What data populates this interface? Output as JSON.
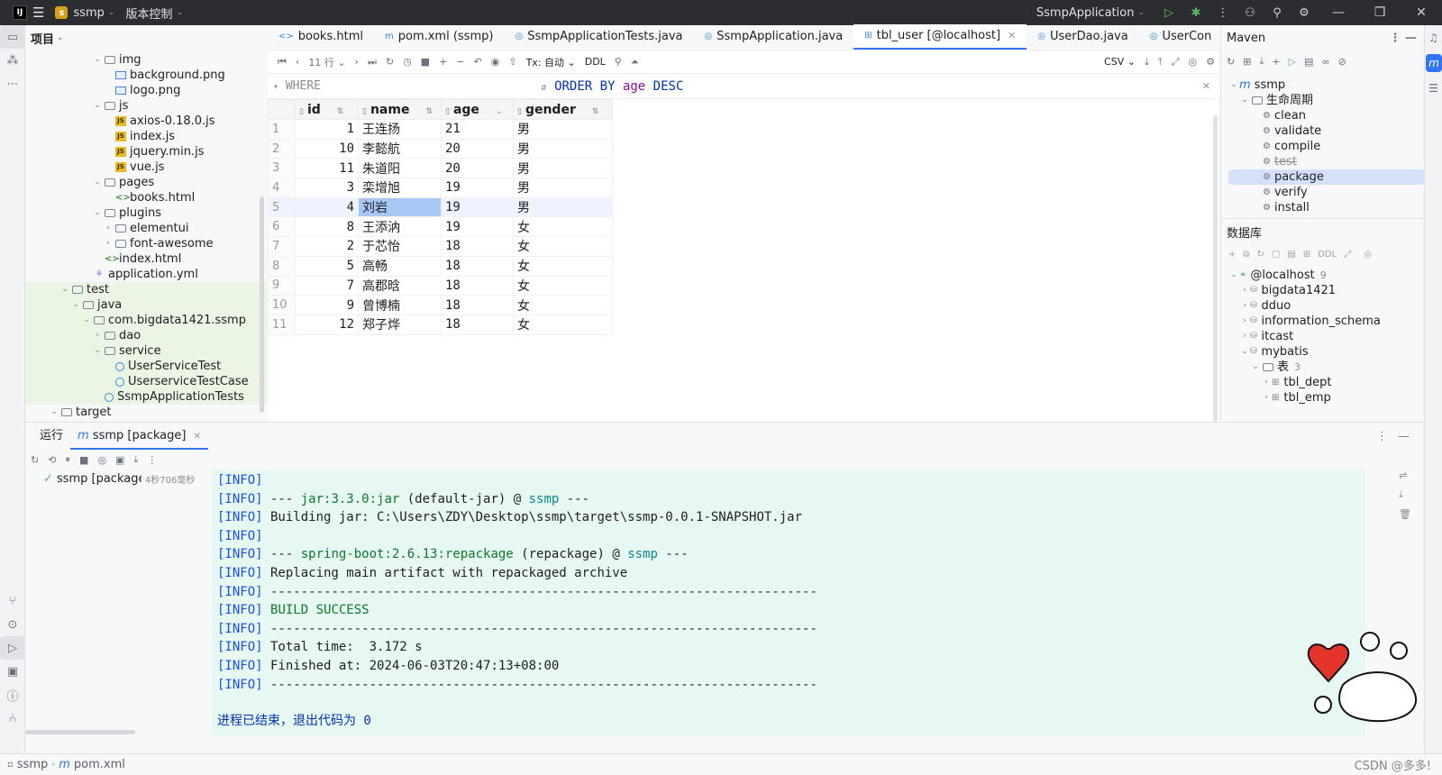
{
  "titlebar": {
    "app_logo": "IJ",
    "project_badge": "s",
    "project_name": "ssmp",
    "vcs_menu": "版本控制",
    "run_config": "SsmpApplication"
  },
  "project_panel": {
    "title": "项目",
    "tree": [
      {
        "label": "img",
        "icon": "folder",
        "indent": 6,
        "tw": "⌄"
      },
      {
        "label": "background.png",
        "icon": "img",
        "indent": 7,
        "tw": ""
      },
      {
        "label": "logo.png",
        "icon": "img",
        "indent": 7,
        "tw": ""
      },
      {
        "label": "js",
        "icon": "folder",
        "indent": 6,
        "tw": "⌄"
      },
      {
        "label": "axios-0.18.0.js",
        "icon": "js",
        "indent": 7,
        "tw": ""
      },
      {
        "label": "index.js",
        "icon": "js",
        "indent": 7,
        "tw": ""
      },
      {
        "label": "jquery.min.js",
        "icon": "js",
        "indent": 7,
        "tw": ""
      },
      {
        "label": "vue.js",
        "icon": "js",
        "indent": 7,
        "tw": ""
      },
      {
        "label": "pages",
        "icon": "folder",
        "indent": 6,
        "tw": "⌄"
      },
      {
        "label": "books.html",
        "icon": "html",
        "indent": 7,
        "tw": ""
      },
      {
        "label": "plugins",
        "icon": "folder",
        "indent": 6,
        "tw": "⌄"
      },
      {
        "label": "elementui",
        "icon": "folder",
        "indent": 7,
        "tw": "›"
      },
      {
        "label": "font-awesome",
        "icon": "folder",
        "indent": 7,
        "tw": "›"
      },
      {
        "label": "index.html",
        "icon": "html",
        "indent": 6,
        "tw": ""
      },
      {
        "label": "application.yml",
        "icon": "yml",
        "indent": 5,
        "tw": ""
      },
      {
        "label": "test",
        "icon": "folder",
        "indent": 3,
        "tw": "⌄",
        "green": true
      },
      {
        "label": "java",
        "icon": "folder",
        "indent": 4,
        "tw": "⌄",
        "green": true
      },
      {
        "label": "com.bigdata1421.ssmp",
        "icon": "folder",
        "indent": 5,
        "tw": "⌄",
        "green": true
      },
      {
        "label": "dao",
        "icon": "folder",
        "indent": 6,
        "tw": "›",
        "green": true
      },
      {
        "label": "service",
        "icon": "folder",
        "indent": 6,
        "tw": "⌄",
        "green": true
      },
      {
        "label": "UserServiceTest",
        "icon": "class",
        "indent": 7,
        "tw": "",
        "green": true
      },
      {
        "label": "UserserviceTestCase",
        "icon": "class",
        "indent": 7,
        "tw": "",
        "green": true
      },
      {
        "label": "SsmpApplicationTests",
        "icon": "class",
        "indent": 6,
        "tw": "",
        "green": true
      },
      {
        "label": "target",
        "icon": "folder",
        "indent": 2,
        "tw": "⌄"
      }
    ]
  },
  "editor": {
    "tabs": [
      {
        "label": "books.html",
        "icon": "<>",
        "active": false
      },
      {
        "label": "pom.xml (ssmp)",
        "icon": "m",
        "active": false
      },
      {
        "label": "SsmpApplicationTests.java",
        "icon": "◎",
        "active": false
      },
      {
        "label": "SsmpApplication.java",
        "icon": "◎",
        "active": false
      },
      {
        "label": "tbl_user [@localhost]",
        "icon": "⊞",
        "active": true
      },
      {
        "label": "UserDao.java",
        "icon": "◎",
        "active": false
      },
      {
        "label": "UserCon",
        "icon": "◎",
        "active": false
      }
    ],
    "grid_toolbar": {
      "rows_label": "11 行",
      "tx_label": "Tx: 自动",
      "ddl_label": "DDL",
      "export_label": "CSV"
    },
    "filter": {
      "where_label": "WHERE",
      "order_by": "ORDER BY",
      "order_col": "age",
      "order_dir": "DESC"
    },
    "table": {
      "columns": [
        "id",
        "name",
        "age",
        "gender"
      ],
      "rows": [
        {
          "n": "1",
          "id": "1",
          "name": "王连扬",
          "age": "21",
          "gender": "男"
        },
        {
          "n": "2",
          "id": "10",
          "name": "李懿航",
          "age": "20",
          "gender": "男"
        },
        {
          "n": "3",
          "id": "11",
          "name": "朱道阳",
          "age": "20",
          "gender": "男"
        },
        {
          "n": "4",
          "id": "3",
          "name": "栾增旭",
          "age": "19",
          "gender": "男"
        },
        {
          "n": "5",
          "id": "4",
          "name": "刘岩",
          "age": "19",
          "gender": "男",
          "selected": true
        },
        {
          "n": "6",
          "id": "8",
          "name": "王添汭",
          "age": "19",
          "gender": "女"
        },
        {
          "n": "7",
          "id": "2",
          "name": "于芯怡",
          "age": "18",
          "gender": "女"
        },
        {
          "n": "8",
          "id": "5",
          "name": "高畅",
          "age": "18",
          "gender": "女"
        },
        {
          "n": "9",
          "id": "7",
          "name": "高郡晗",
          "age": "18",
          "gender": "女"
        },
        {
          "n": "10",
          "id": "9",
          "name": "曾博楠",
          "age": "18",
          "gender": "女"
        },
        {
          "n": "11",
          "id": "12",
          "name": "郑子烨",
          "age": "18",
          "gender": "女"
        }
      ]
    }
  },
  "maven": {
    "title": "Maven",
    "project": "ssmp",
    "lifecycle": "生命周期",
    "goals": [
      {
        "label": "clean",
        "strike": false,
        "selected": false
      },
      {
        "label": "validate",
        "strike": false,
        "selected": false
      },
      {
        "label": "compile",
        "strike": false,
        "selected": false
      },
      {
        "label": "test",
        "strike": true,
        "selected": false
      },
      {
        "label": "package",
        "strike": false,
        "selected": true
      },
      {
        "label": "verify",
        "strike": false,
        "selected": false
      },
      {
        "label": "install",
        "strike": false,
        "selected": false
      }
    ]
  },
  "database": {
    "title": "数据库",
    "host": "@localhost",
    "host_count": "9",
    "schemas": [
      "bigdata1421",
      "dduo",
      "information_schema",
      "itcast",
      "mybatis"
    ],
    "tables_label": "表",
    "tables_count": "3",
    "tables": [
      "tbl_dept",
      "tbl_emp"
    ]
  },
  "run": {
    "tab_run": "运行",
    "tab_config": "ssmp [package]",
    "tree_item": "ssmp [package]",
    "duration": "4秒706毫秒",
    "lines": [
      {
        "pre": "[INFO]",
        "parts": [
          {
            "t": "",
            "c": ""
          }
        ]
      },
      {
        "pre": "[INFO]",
        "parts": [
          {
            "t": " --- ",
            "c": ""
          },
          {
            "t": "jar:3.3.0:jar",
            "c": "grn"
          },
          {
            "t": " (default-jar) @ ",
            "c": ""
          },
          {
            "t": "ssmp",
            "c": "teal"
          },
          {
            "t": " ---",
            "c": ""
          }
        ]
      },
      {
        "pre": "[INFO]",
        "parts": [
          {
            "t": " Building jar: C:\\Users\\ZDY\\Desktop\\ssmp\\target\\ssmp-0.0.1-SNAPSHOT.jar",
            "c": ""
          }
        ]
      },
      {
        "pre": "[INFO]",
        "parts": [
          {
            "t": "",
            "c": ""
          }
        ]
      },
      {
        "pre": "[INFO]",
        "parts": [
          {
            "t": " --- ",
            "c": ""
          },
          {
            "t": "spring-boot:2.6.13:repackage",
            "c": "grn"
          },
          {
            "t": " (repackage) @ ",
            "c": ""
          },
          {
            "t": "ssmp",
            "c": "teal"
          },
          {
            "t": " ---",
            "c": ""
          }
        ]
      },
      {
        "pre": "[INFO]",
        "parts": [
          {
            "t": " Replacing main artifact with repackaged archive",
            "c": ""
          }
        ]
      },
      {
        "pre": "[INFO]",
        "parts": [
          {
            "t": " ------------------------------------------------------------------------",
            "c": ""
          }
        ]
      },
      {
        "pre": "[INFO]",
        "parts": [
          {
            "t": " ",
            "c": ""
          },
          {
            "t": "BUILD SUCCESS",
            "c": "grn"
          }
        ]
      },
      {
        "pre": "[INFO]",
        "parts": [
          {
            "t": " ------------------------------------------------------------------------",
            "c": ""
          }
        ]
      },
      {
        "pre": "[INFO]",
        "parts": [
          {
            "t": " Total time:  3.172 s",
            "c": ""
          }
        ]
      },
      {
        "pre": "[INFO]",
        "parts": [
          {
            "t": " Finished at: 2024-06-03T20:47:13+08:00",
            "c": ""
          }
        ]
      },
      {
        "pre": "[INFO]",
        "parts": [
          {
            "t": " ------------------------------------------------------------------------",
            "c": ""
          }
        ]
      }
    ],
    "exit_message": "进程已结束，退出代码为 0"
  },
  "statusbar": {
    "project": "ssmp",
    "file": "pom.xml",
    "watermark": "CSDN @多多!"
  },
  "colors": {
    "accent": "#3574f0",
    "console_bg": "#e7f7f1",
    "selection": "#a9c7f5",
    "success": "#0a7b2c"
  }
}
